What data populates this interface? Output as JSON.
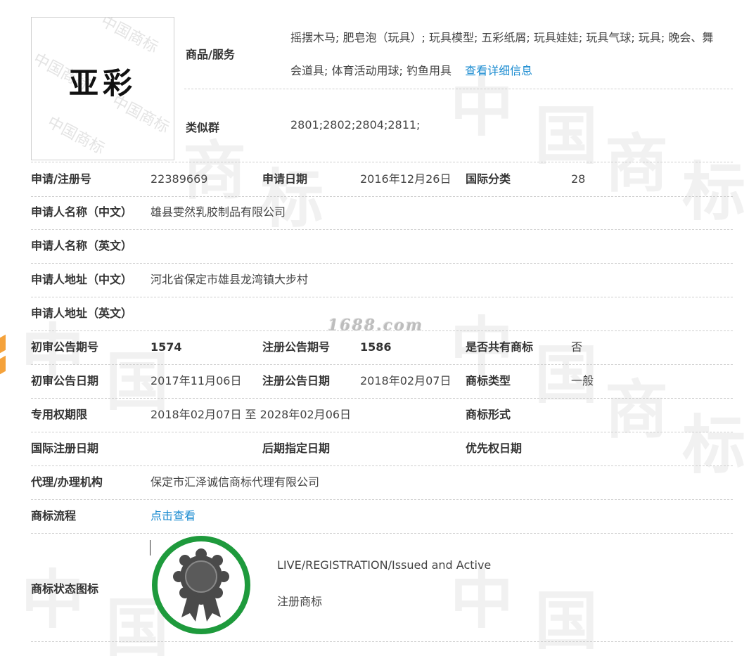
{
  "watermark": {
    "char1": "中",
    "char2": "国",
    "char3": "商",
    "char4": "标",
    "logo_wm": "中国商标",
    "site": "1688.com"
  },
  "trademark": {
    "logo_text": "亚彩"
  },
  "goods": {
    "label": "商品/服务",
    "line1": "摇摆木马; 肥皂泡（玩具）; 玩具模型; 五彩纸屑; 玩具娃娃; 玩具气球; 玩具; 晚会、舞",
    "line2": "会道具; 体育活动用球; 钓鱼用具",
    "detail_link": "查看详细信息"
  },
  "similar_group": {
    "label": "类似群",
    "value": "2801;2802;2804;2811;"
  },
  "rows": {
    "reg_no_label": "申请/注册号",
    "reg_no": "22389669",
    "app_date_label": "申请日期",
    "app_date": "2016年12月26日",
    "intl_class_label": "国际分类",
    "intl_class": "28",
    "applicant_cn_label": "申请人名称（中文）",
    "applicant_cn": "雄县雯然乳胶制品有限公司",
    "applicant_en_label": "申请人名称（英文）",
    "applicant_en": "",
    "address_cn_label": "申请人地址（中文）",
    "address_cn": "河北省保定市雄县龙湾镇大步村",
    "address_en_label": "申请人地址（英文）",
    "address_en": "",
    "prelim_no_label": "初审公告期号",
    "prelim_no": "1574",
    "reg_pub_no_label": "注册公告期号",
    "reg_pub_no": "1586",
    "shared_label": "是否共有商标",
    "shared": "否",
    "prelim_date_label": "初审公告日期",
    "prelim_date": "2017年11月06日",
    "reg_pub_date_label": "注册公告日期",
    "reg_pub_date": "2018年02月07日",
    "tm_type_label": "商标类型",
    "tm_type": "一般",
    "term_label": "专用权期限",
    "term": "2018年02月07日 至 2028年02月06日",
    "tm_form_label": "商标形式",
    "tm_form": "",
    "intl_reg_date_label": "国际注册日期",
    "intl_reg_date": "",
    "later_date_label": "后期指定日期",
    "later_date": "",
    "priority_label": "优先权日期",
    "priority": "",
    "agent_label": "代理/办理机构",
    "agent": "保定市汇泽诚信商标代理有限公司",
    "process_label": "商标流程",
    "process_link": "点击查看",
    "status_icon_label": "商标状态图标",
    "status_en": "LIVE/REGISTRATION/Issued and Active",
    "status_cn": "注册商标"
  },
  "colors": {
    "link": "#1a8bd0",
    "badge_ring": "#1e9a3c",
    "badge_body": "#4a4a4a",
    "accent_left": "#f5a23b"
  }
}
